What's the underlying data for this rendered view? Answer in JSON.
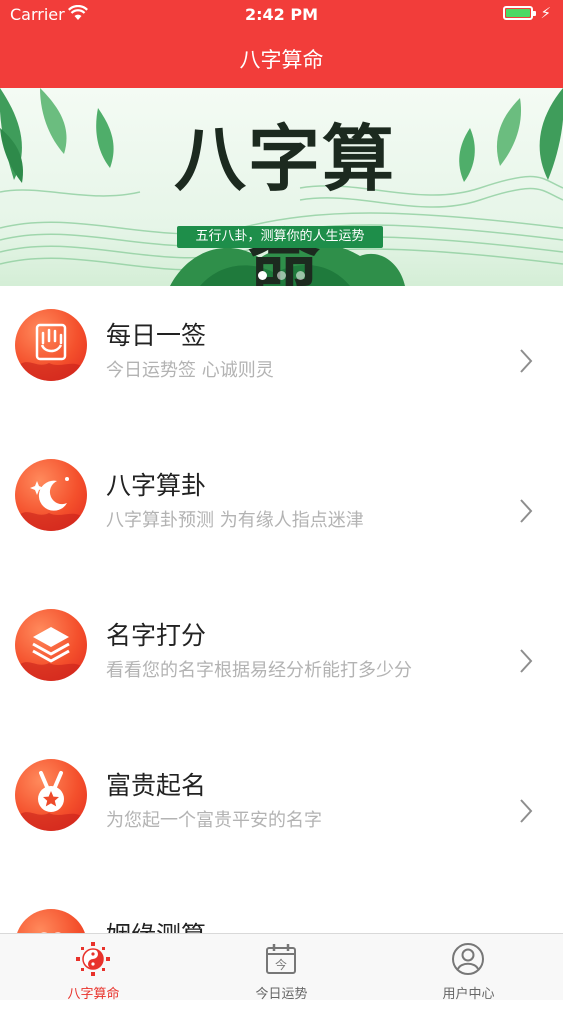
{
  "status_bar": {
    "carrier": "Carrier",
    "time": "2:42 PM"
  },
  "nav": {
    "title": "八字算命"
  },
  "banner": {
    "title": "八字算命",
    "subtitle": "五行八卦，测算你的人生运势",
    "dots": {
      "count": 3,
      "active_index": 0
    }
  },
  "menu": {
    "items": [
      {
        "title": "每日一签",
        "subtitle": "今日运势签 心诚则灵",
        "icon": "hand-icon"
      },
      {
        "title": "八字算卦",
        "subtitle": "八字算卦预测 为有缘人指点迷津",
        "icon": "moon-icon"
      },
      {
        "title": "名字打分",
        "subtitle": "看看您的名字根据易经分析能打多少分",
        "icon": "layers-icon"
      },
      {
        "title": "富贵起名",
        "subtitle": "为您起一个富贵平安的名字",
        "icon": "medal-icon"
      },
      {
        "title": "姻缘测算",
        "subtitle": "",
        "icon": "heart-icon"
      }
    ]
  },
  "tabbar": {
    "tabs": [
      {
        "label": "八字算命",
        "icon": "yin-yang-icon",
        "active": true
      },
      {
        "label": "今日运势",
        "icon": "calendar-icon",
        "active": false
      },
      {
        "label": "用户中心",
        "icon": "user-icon",
        "active": false
      }
    ]
  },
  "colors": {
    "accent": "#f23d3a",
    "banner_green": "#1e8e4a"
  }
}
